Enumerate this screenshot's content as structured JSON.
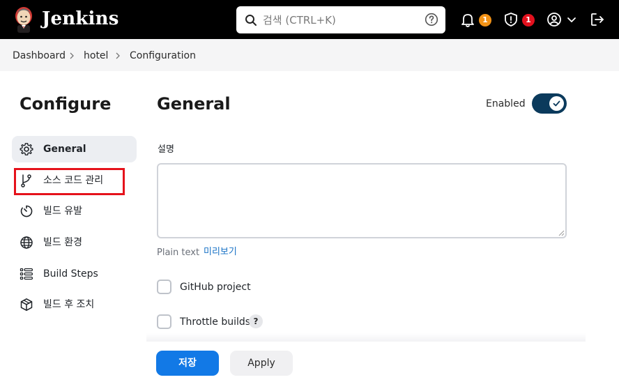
{
  "header": {
    "brand": "Jenkins",
    "search_placeholder": "검색 (CTRL+K)",
    "notifications_count": "1",
    "security_count": "1",
    "colors": {
      "bar": "#000000",
      "badge_notifications": "#f29216",
      "badge_security": "#e3111e"
    },
    "icons": [
      "jenkins-logo-icon",
      "search-icon",
      "help-icon",
      "bell-icon",
      "shield-icon",
      "user-icon",
      "chevron-down-icon",
      "logout-icon"
    ]
  },
  "breadcrumb": {
    "items": [
      "Dashboard",
      "hotel",
      "Configuration"
    ]
  },
  "sidebar": {
    "title": "Configure",
    "items": [
      {
        "label": "General",
        "icon": "gear-icon",
        "active": true
      },
      {
        "label": "소스 코드 관리",
        "icon": "git-branch-icon",
        "active": false
      },
      {
        "label": "빌드 유발",
        "icon": "timer-icon",
        "active": false
      },
      {
        "label": "빌드 환경",
        "icon": "globe-icon",
        "active": false
      },
      {
        "label": "Build Steps",
        "icon": "list-icon",
        "active": false
      },
      {
        "label": "빌드 후 조치",
        "icon": "package-icon",
        "active": false
      }
    ]
  },
  "main": {
    "section_title": "General",
    "enabled_label": "Enabled",
    "enabled": true,
    "description_label": "설명",
    "description_value": "",
    "plain_text": "Plain text",
    "preview_link": "미리보기",
    "options": [
      {
        "label": "GitHub project",
        "checked": false
      },
      {
        "label": "Throttle builds",
        "checked": false,
        "help": "?"
      }
    ]
  },
  "footer": {
    "save_label": "저장",
    "apply_label": "Apply",
    "accent": "#1279e6"
  }
}
